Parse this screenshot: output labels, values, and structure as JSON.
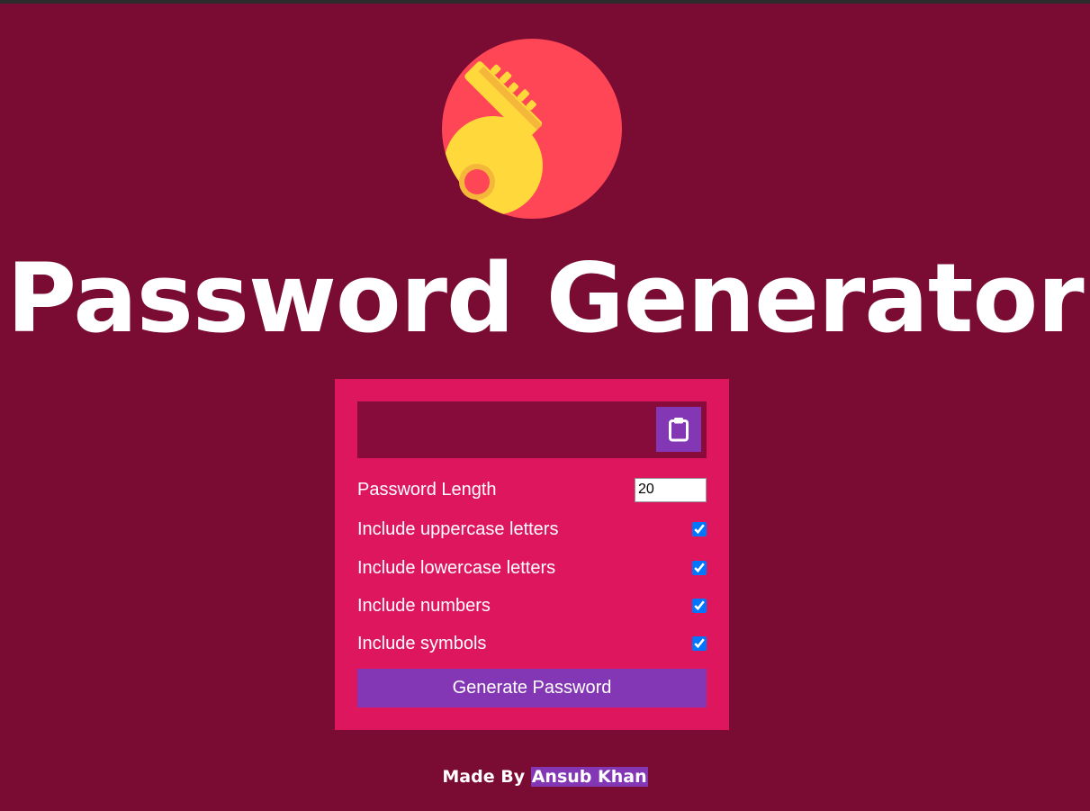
{
  "logo": {
    "icon": "key-icon",
    "circle_color": "#ff4656",
    "key_color": "#ffd93b"
  },
  "header": {
    "title": "Password Generator"
  },
  "generator": {
    "result_value": "",
    "clipboard_icon": "clipboard-icon",
    "settings": {
      "length_label": "Password Length",
      "length_value": "20",
      "uppercase_label": "Include uppercase letters",
      "lowercase_label": "Include lowercase letters",
      "numbers_label": "Include numbers",
      "symbols_label": "Include symbols"
    },
    "options_checked": {
      "uppercase": true,
      "lowercase": true,
      "numbers": true,
      "symbols": true
    },
    "generate_label": "Generate Password"
  },
  "footer": {
    "made_by": "Made By",
    "author": "Ansub Khan"
  },
  "colors": {
    "background": "#7a0b32",
    "card": "#de165e",
    "result": "#880c3b",
    "accent": "#8337b5"
  }
}
